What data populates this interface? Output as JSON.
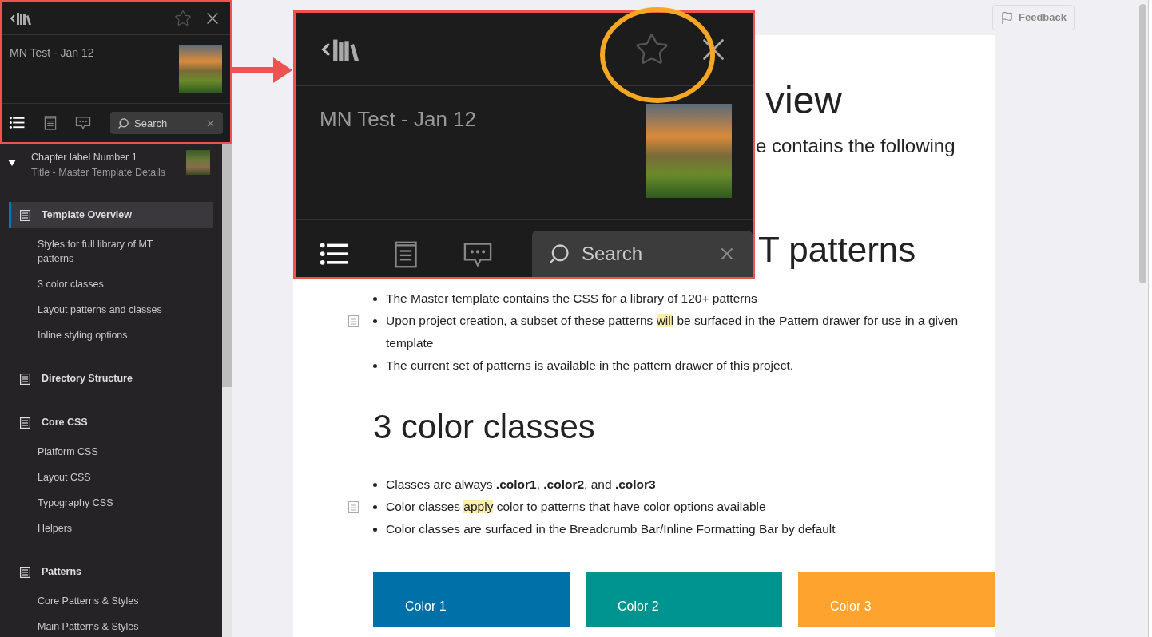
{
  "sidebar": {
    "header": {
      "favorite": false,
      "title": "MN Test - Jan 12",
      "tabs": [
        {
          "kind": "contents",
          "selected": true
        },
        {
          "kind": "page",
          "selected": false
        },
        {
          "kind": "comments",
          "selected": false
        }
      ],
      "search": {
        "placeholder": "Search"
      }
    },
    "chapter": {
      "label": "Chapter label Number 1",
      "subtitle": "Title - Master Template Details",
      "expanded": true
    },
    "toc": [
      {
        "label": "Template Overview",
        "selected": true,
        "children": [
          {
            "label": "Styles for full library of MT patterns"
          },
          {
            "label": "3 color classes"
          },
          {
            "label": "Layout patterns and classes"
          },
          {
            "label": "Inline styling options"
          }
        ]
      },
      {
        "label": "Directory Structure",
        "selected": false
      },
      {
        "label": "Core CSS",
        "selected": false,
        "children": [
          {
            "label": "Platform CSS"
          },
          {
            "label": "Layout CSS"
          },
          {
            "label": "Typography CSS"
          },
          {
            "label": "Helpers"
          }
        ]
      },
      {
        "label": "Patterns",
        "selected": false,
        "children": [
          {
            "label": "Core Patterns & Styles"
          },
          {
            "label": "Main Patterns & Styles"
          }
        ]
      }
    ]
  },
  "callout": {
    "favorite": false,
    "title": "MN Test - Jan 12",
    "tabs": [
      {
        "kind": "contents",
        "selected": true
      },
      {
        "kind": "page",
        "selected": false
      },
      {
        "kind": "comments",
        "selected": false
      }
    ],
    "search": {
      "placeholder": "Search"
    }
  },
  "feedback_button": "Feedback",
  "document": {
    "title_fragment": "view",
    "intro_fragment": "e contains the following",
    "section_fragment": "T patterns",
    "list_1": [
      {
        "note": false,
        "segments": [
          {
            "text": "The Master template contains the CSS for a library of 120+ patterns",
            "highlight": false
          }
        ]
      },
      {
        "note": true,
        "segments": [
          {
            "text": "Upon project creation, a subset of these patterns ",
            "highlight": false
          },
          {
            "text": "will",
            "highlight": true
          },
          {
            "text": " be surfaced in the Pattern drawer for use in a given template",
            "highlight": false
          }
        ]
      },
      {
        "note": false,
        "segments": [
          {
            "text": "The current set of patterns is available in the pattern drawer of this project.",
            "highlight": false
          }
        ]
      }
    ],
    "section_2": "3 color classes",
    "list_2": [
      {
        "note": false,
        "segments": [
          {
            "text": "Classes are always **.color1**, **.color2**, and **.color3**",
            "highlight": false
          }
        ]
      },
      {
        "note": true,
        "segments": [
          {
            "text": "Color classes ",
            "highlight": false
          },
          {
            "text": "apply",
            "highlight": true
          },
          {
            "text": " color to patterns that have color options available",
            "highlight": false
          }
        ]
      },
      {
        "note": false,
        "segments": [
          {
            "text": "Color classes are surfaced in the Breadcrumb Bar/Inline Formatting Bar by default",
            "highlight": false
          }
        ]
      }
    ],
    "color_cards": [
      {
        "label": "Color 1",
        "color": "#0070a8"
      },
      {
        "label": "Color 2",
        "color": "#009490"
      },
      {
        "label": "Color 3",
        "color": "#fda32e"
      }
    ]
  }
}
